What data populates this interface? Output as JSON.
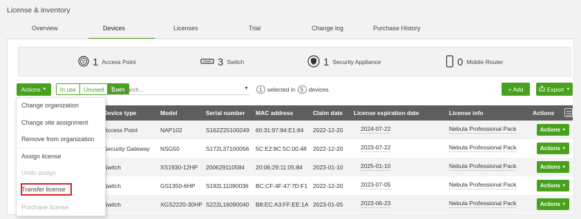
{
  "page_title": "License & inventory",
  "tabs": [
    {
      "label": "Overview"
    },
    {
      "label": "Devices"
    },
    {
      "label": "Licenses"
    },
    {
      "label": "Trial"
    },
    {
      "label": "Change log"
    },
    {
      "label": "Purchase History"
    }
  ],
  "active_tab": "Devices",
  "summary": [
    {
      "count": "1",
      "label": "Access Point",
      "icon": "access-point-icon"
    },
    {
      "count": "3",
      "label": "Switch",
      "icon": "switch-icon"
    },
    {
      "count": "1",
      "label": "Security Appliance",
      "icon": "shield-icon"
    },
    {
      "count": "0",
      "label": "Mobile Router",
      "icon": "mobile-router-icon"
    }
  ],
  "toolbar": {
    "actions_label": "Actions",
    "filter": {
      "in_use": "In use",
      "unused": "Unused",
      "both": "Both"
    },
    "search_placeholder": "Search...",
    "selected_count": "1",
    "selected_text": "selected in",
    "device_count": "5",
    "devices_text": "devices.",
    "add_label": "+ Add",
    "export_label": "Export"
  },
  "table": {
    "headers": {
      "device_type": "Device type",
      "model": "Model",
      "serial": "Serial number",
      "mac": "MAC address",
      "claim_date": "Claim date",
      "expiration": "License expiration date",
      "license_info": "License info",
      "actions": "Actions"
    },
    "rows": [
      {
        "device_type": "Access Point",
        "model": "NAP102",
        "serial": "S162Z25100249",
        "mac": "60:31:97:84:E1:84",
        "claim_date": "2022-12-20",
        "expiration": "2024-07-22",
        "license_info": "Nebula Professional Pack",
        "action": "Actions"
      },
      {
        "device_type": "Security Gateway",
        "model": "NSG50",
        "serial": "S172L37100056",
        "mac": "5C:E2:8C:5C:00:48",
        "claim_date": "2022-12-20",
        "expiration": "2023-07-22",
        "license_info": "Nebula Professional Pack",
        "action": "Actions"
      },
      {
        "device_type": "Switch",
        "model": "XS1930-12HP",
        "serial": "200629110584",
        "mac": "20:06:29:11:05:84",
        "claim_date": "2023-01-10",
        "expiration": "2025-01-10",
        "license_info": "Nebula Professional Pack",
        "action": "Actions"
      },
      {
        "device_type": "Switch",
        "model": "GS1350-6HP",
        "serial": "S192L11090036",
        "mac": "BC:CF:4F:47:7D:F1",
        "claim_date": "2022-12-20",
        "expiration": "2023-07-05",
        "license_info": "Nebula Professional Pack",
        "action": "Actions"
      },
      {
        "device_type": "Switch",
        "model": "XGS2220-30HP",
        "serial": "S222L16090040",
        "mac": "B8:EC:A3:FF:EE:1A",
        "claim_date": "2023-01-05",
        "expiration": "2023-06-23",
        "license_info": "Nebula Professional Pack",
        "action": "Actions"
      }
    ]
  },
  "actions_menu": {
    "items": [
      {
        "label": "Change organization",
        "enabled": true
      },
      {
        "label": "Change site assignment",
        "enabled": true
      },
      {
        "label": "Remove from organization",
        "enabled": true
      },
      {
        "label": "Assign license",
        "enabled": true
      },
      {
        "label": "Undo assign",
        "enabled": false
      },
      {
        "label": "Transfer license",
        "enabled": true,
        "highlighted": true
      },
      {
        "label": "Purchase license",
        "enabled": false
      }
    ]
  },
  "colors": {
    "accent_green": "#47a11c",
    "header_gray": "#5e5e5e",
    "highlight_red": "#e01b1b"
  }
}
